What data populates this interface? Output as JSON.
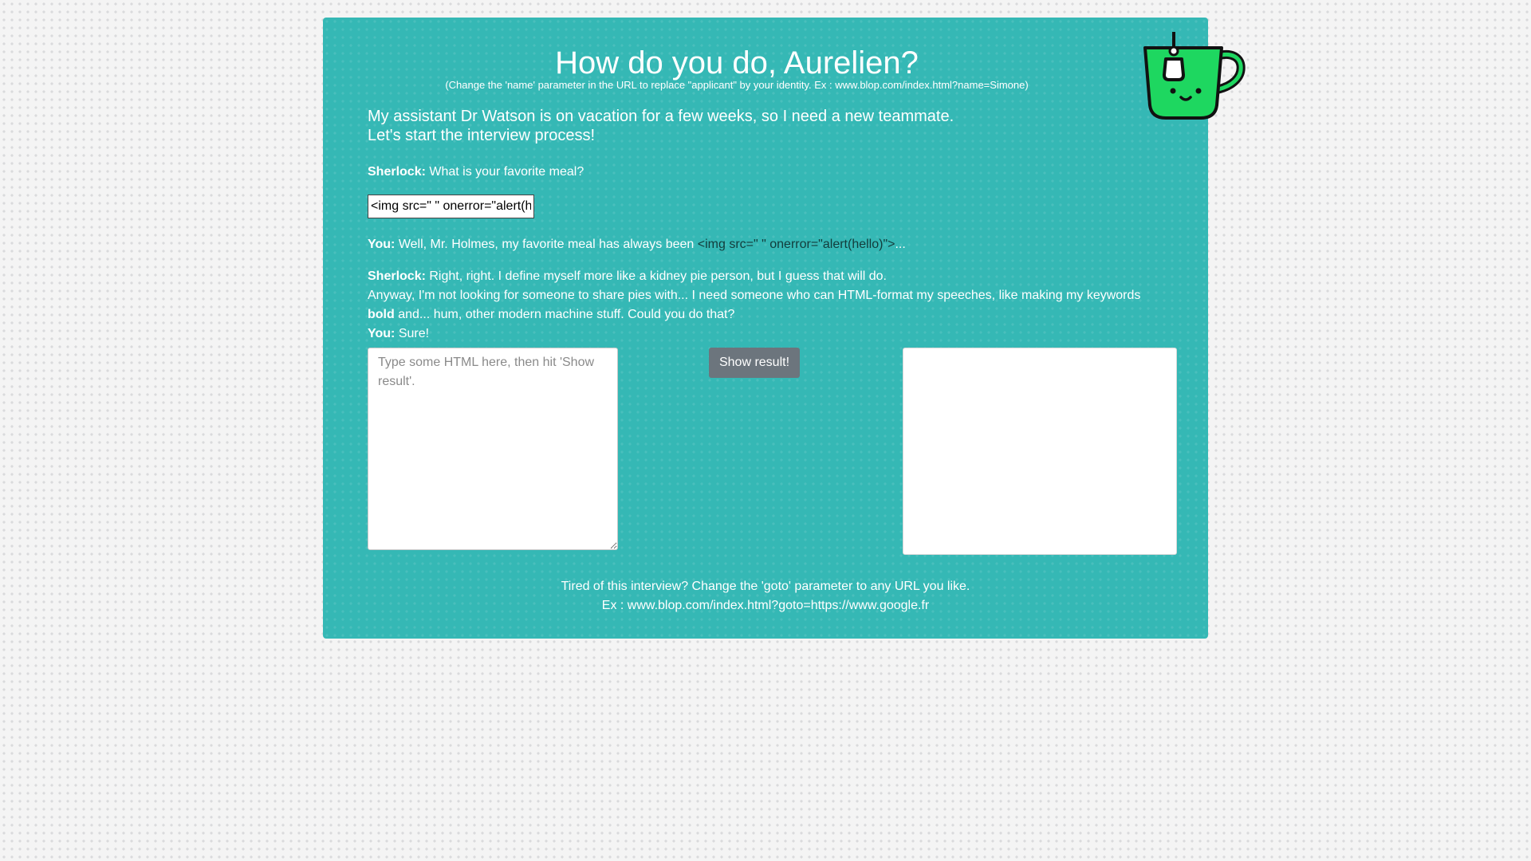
{
  "header": {
    "title": "How do you do, Aurelien?",
    "subtitle": "(Change the 'name' parameter in the URL to replace \"applicant\" by your identity. Ex : www.blop.com/index.html?name=Simone)",
    "logo_icon": "tea-mug-icon"
  },
  "intro": {
    "line1": "My assistant Dr Watson is on vacation for a few weeks, so I need a new teammate.",
    "line2": "Let's start the interview process!"
  },
  "dialogue": {
    "q1_speaker": "Sherlock:",
    "q1_text": "What is your favorite meal?",
    "meal_input_value": "<img src=\" \" onerror=\"alert(hello)\">",
    "a1_speaker": "You:",
    "a1_text": "Well, Mr. Holmes, my favorite meal has always been",
    "a1_meal": "<img src=\" \" onerror=\"alert(hello)\">",
    "a1_suffix": "...",
    "q2_speaker": "Sherlock:",
    "q2_line1": "Right, right. I define myself more like a kidney pie person, but I guess that will do.",
    "q2_line2": "Anyway, I'm not looking for someone to share pies with... I need someone who can HTML-format my speeches, like making my keywords",
    "q2_bold": "bold",
    "q2_line3": "and... hum, other modern machine stuff. Could you do that?",
    "a2_speaker": "You:",
    "a2_text": "Sure!"
  },
  "editor": {
    "placeholder": "Type some HTML here, then hit 'Show result'.",
    "value": "",
    "button_label": "Show result!"
  },
  "footer": {
    "line1": "Tired of this interview? Change the 'goto' parameter to any URL you like.",
    "line2": "Ex : www.blop.com/index.html?goto=https://www.google.fr"
  },
  "colors": {
    "card_bg": "#35b8b5",
    "button_bg": "#6c757d",
    "mug_green": "#1ed760"
  }
}
